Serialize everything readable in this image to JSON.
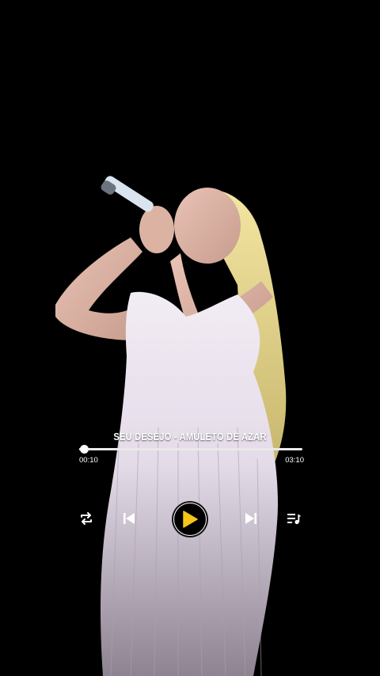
{
  "player": {
    "track_title": "SEU DESEJO - AMULETO DE AZAR",
    "elapsed": "00:10",
    "duration": "03:10",
    "progress_fraction": 0.02
  },
  "controls": {
    "repeat_icon": "repeat-icon",
    "previous_icon": "skip-previous-icon",
    "play_icon": "play-icon",
    "next_icon": "skip-next-icon",
    "queue_icon": "playlist-icon"
  },
  "colors": {
    "accent": "#f5c518",
    "background": "#000000",
    "foreground": "#ffffff"
  }
}
